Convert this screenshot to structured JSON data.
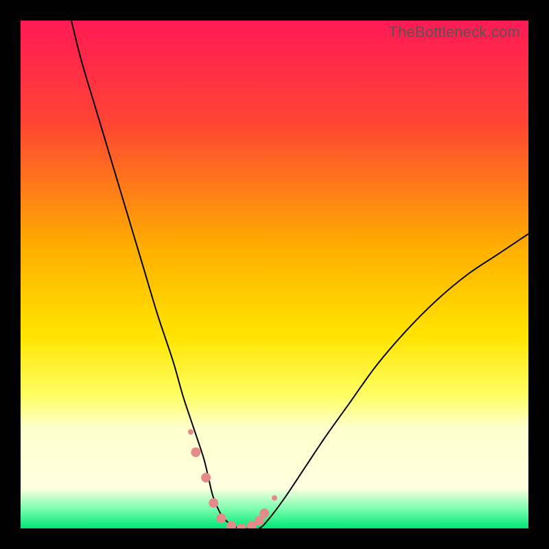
{
  "watermark": "TheBottleneck.com",
  "chart_data": {
    "type": "line",
    "title": "",
    "xlabel": "",
    "ylabel": "",
    "xlim": [
      0,
      100
    ],
    "ylim": [
      0,
      100
    ],
    "background_gradient_stops": [
      {
        "pct": 0,
        "color": "#ff1a55"
      },
      {
        "pct": 20,
        "color": "#ff4433"
      },
      {
        "pct": 45,
        "color": "#ffb000"
      },
      {
        "pct": 62,
        "color": "#ffe400"
      },
      {
        "pct": 74,
        "color": "#ffff66"
      },
      {
        "pct": 80,
        "color": "#ffffcc"
      },
      {
        "pct": 92,
        "color": "#ffffe0"
      },
      {
        "pct": 96,
        "color": "#80ffb0"
      },
      {
        "pct": 100,
        "color": "#00e676"
      }
    ],
    "series": [
      {
        "name": "curve",
        "color": "#000000",
        "width": 2,
        "x": [
          10,
          12,
          15,
          18,
          21,
          24,
          27,
          30,
          32,
          34,
          36,
          37,
          38,
          40,
          43,
          45,
          47,
          49,
          52,
          56,
          60,
          65,
          70,
          76,
          82,
          88,
          94,
          100
        ],
        "y": [
          100,
          92,
          82,
          72,
          62,
          52,
          42,
          33,
          26,
          20,
          14,
          10,
          6,
          2,
          0,
          0,
          0,
          2,
          6,
          12,
          18,
          25,
          32,
          39,
          45,
          50,
          54,
          58
        ]
      }
    ],
    "markers": {
      "color": "#e38b88",
      "radius_small": 4,
      "radius_large": 7,
      "points": [
        {
          "x": 33.5,
          "y": 19,
          "r": "small"
        },
        {
          "x": 34.5,
          "y": 15,
          "r": "large"
        },
        {
          "x": 36.5,
          "y": 10,
          "r": "large"
        },
        {
          "x": 38,
          "y": 5,
          "r": "large"
        },
        {
          "x": 39.5,
          "y": 2,
          "r": "large"
        },
        {
          "x": 41.5,
          "y": 0.5,
          "r": "large"
        },
        {
          "x": 43.5,
          "y": 0,
          "r": "large"
        },
        {
          "x": 45.5,
          "y": 0.5,
          "r": "large"
        },
        {
          "x": 47,
          "y": 1.5,
          "r": "large"
        },
        {
          "x": 48,
          "y": 3,
          "r": "large"
        },
        {
          "x": 50,
          "y": 6,
          "r": "small"
        }
      ]
    }
  }
}
